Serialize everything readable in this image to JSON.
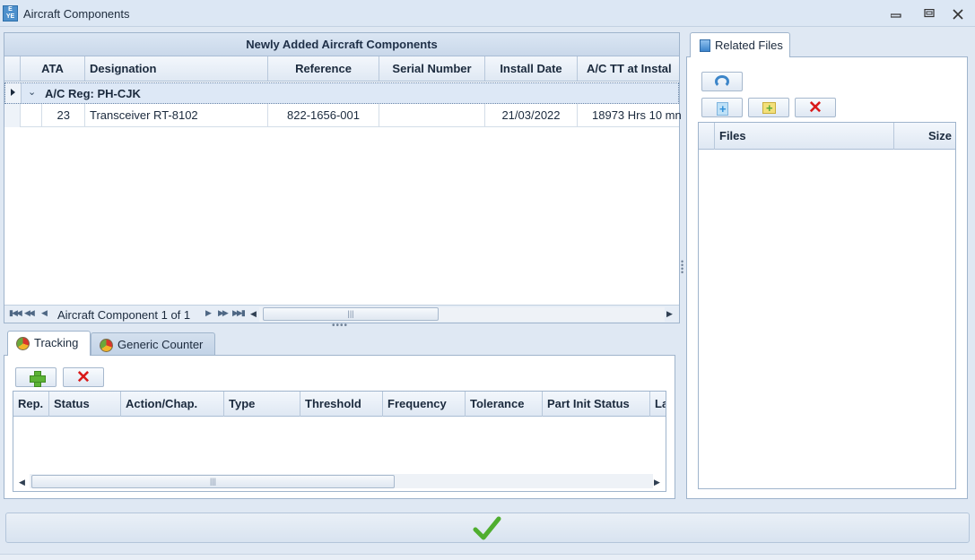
{
  "window": {
    "title": "Aircraft Components",
    "icon_text": "E YE"
  },
  "components_grid": {
    "caption": "Newly Added Aircraft Components",
    "columns": [
      "ATA",
      "Designation",
      "Reference",
      "Serial Number",
      "Install Date",
      "A/C TT at Instal"
    ],
    "group_label": "A/C Reg: PH-CJK",
    "rows": [
      {
        "ata": "23",
        "designation": "Transceiver RT-8102",
        "reference": "822-1656-001",
        "serial": "",
        "install_date": "21/03/2022",
        "ac_tt": "18973 Hrs 10 mn"
      }
    ],
    "navigator_text": "Aircraft Component 1 of 1"
  },
  "tabs": {
    "tracking": "Tracking",
    "generic_counter": "Generic Counter"
  },
  "tracking_grid": {
    "columns": [
      "Rep.",
      "Status",
      "Action/Chap.",
      "Type",
      "Threshold",
      "Frequency",
      "Tolerance",
      "Part Init Status",
      "La"
    ]
  },
  "related_files": {
    "tab_label": "Related Files",
    "columns": [
      "Files",
      "Size"
    ]
  },
  "colors": {
    "accent_blue": "#3d86c9",
    "add_green": "#5cb335",
    "delete_red": "#d91a1a",
    "confirm_green": "#4fae2f"
  }
}
